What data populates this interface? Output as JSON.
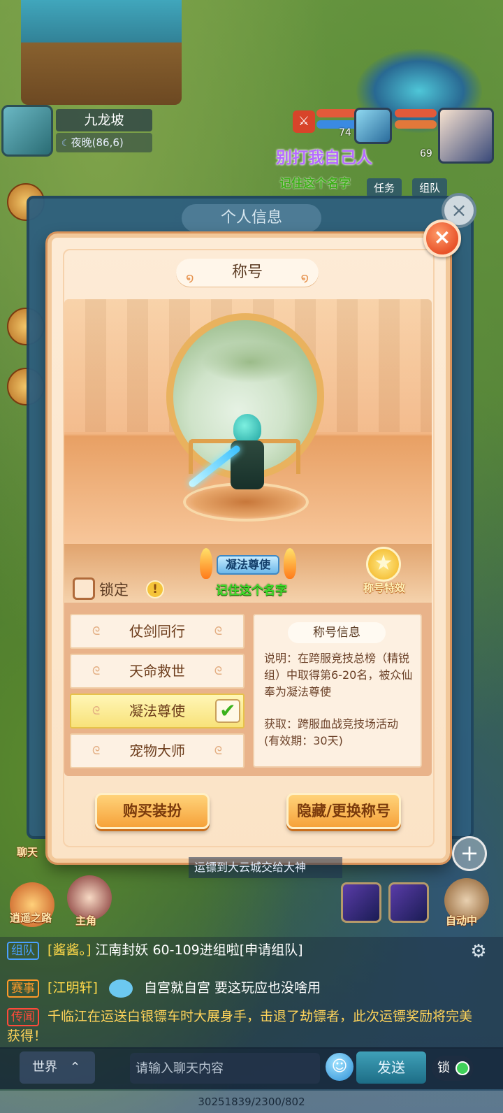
{
  "location": {
    "map_name": "九龙坡",
    "time_coords": "夜晚(86,6)"
  },
  "party": {
    "member1_level": "74",
    "member2_level": "69"
  },
  "world_player": {
    "name": "别打我自己人",
    "title": "记住这个名字"
  },
  "top_pills": [
    "任务",
    "组队"
  ],
  "under_panel": {
    "title": "个人信息"
  },
  "modal": {
    "title": "称号",
    "close_label": "×"
  },
  "lock": {
    "label": "锁定",
    "warn": "!"
  },
  "equipped_title": {
    "name": "凝法尊使",
    "subtitle": "记住这个名字"
  },
  "fx": {
    "label": "称号特效",
    "star": "★"
  },
  "titles": [
    {
      "label": "仗剑同行",
      "selected": false
    },
    {
      "label": "天命救世",
      "selected": false
    },
    {
      "label": "凝法尊使",
      "selected": true
    },
    {
      "label": "宠物大师",
      "selected": false
    }
  ],
  "info": {
    "header": "称号信息",
    "description": "说明：在跨服竞技总榜（精锐组）中取得第6-20名，被众仙奉为凝法尊使",
    "obtain": "获取：跨服血战竞技场活动(有效期：30天)"
  },
  "buttons": {
    "buy": "购买装扮",
    "hide_change": "隐藏/更换称号"
  },
  "hud": {
    "convoy_text": "运镖到大云城交给大神",
    "chat_label": "聊天",
    "quest_road": "逍遥之路",
    "hero_label": "主角",
    "auto_label": "自动中",
    "plus": "+"
  },
  "chat_lines": [
    {
      "tag": "组队",
      "tag_color": "#4aa0ff",
      "name": "[酱酱。]",
      "text": "江南封妖 60-109进组啦[申请组队]"
    },
    {
      "tag": "赛事",
      "tag_color": "#ff9a2a",
      "name": "[江明轩]",
      "text": "自宫就自宫 要这玩应也没啥用"
    },
    {
      "tag": "传闻",
      "tag_color": "#ff4a3a",
      "name": "",
      "text": "千临江在运送白银镖车时大展身手，击退了劫镖者，此次运镖奖励将完美获得！"
    }
  ],
  "bottom": {
    "channel": "世界",
    "input_placeholder": "请输入聊天内容",
    "send": "发送",
    "lock": "锁"
  },
  "footer": "30251839/2300/802",
  "colors": {
    "accent_orange": "#f6a23a",
    "modal_bg": "#fdebd6",
    "selected_row": "#f8e27a"
  }
}
